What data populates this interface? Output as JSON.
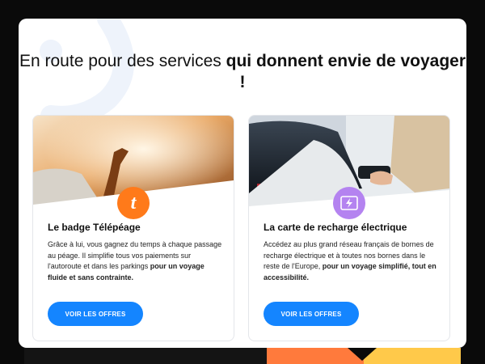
{
  "page": {
    "title_normal": "En route pour des services ",
    "title_bold": "qui donnent envie de voyager !"
  },
  "cards": [
    {
      "title": "Le badge Télépéage",
      "desc_normal": "Grâce à lui, vous gagnez du temps à chaque passage au péage. Il simplifie tous vos paiements sur l'autoroute et dans les parkings ",
      "desc_bold": "pour un voyage fluide et sans contrainte.",
      "cta": "VOIR LES OFFRES",
      "icon": "telepeage-t-icon",
      "icon_glyph": "t",
      "icon_color": "#ff7a1a"
    },
    {
      "title": "La carte de recharge électrique",
      "desc_normal": "Accédez au plus grand réseau français de bornes de recharge électrique et à toutes nos bornes dans le reste de l'Europe, ",
      "desc_bold": "pour un voyage simplifié, tout en accessibilité.",
      "cta": "VOIR LES OFFRES",
      "icon": "charging-card-icon",
      "icon_color": "#b483f0"
    }
  ],
  "colors": {
    "cta": "#1485ff",
    "accent_orange": "#ff7a3c",
    "accent_yellow": "#ffc94a"
  }
}
